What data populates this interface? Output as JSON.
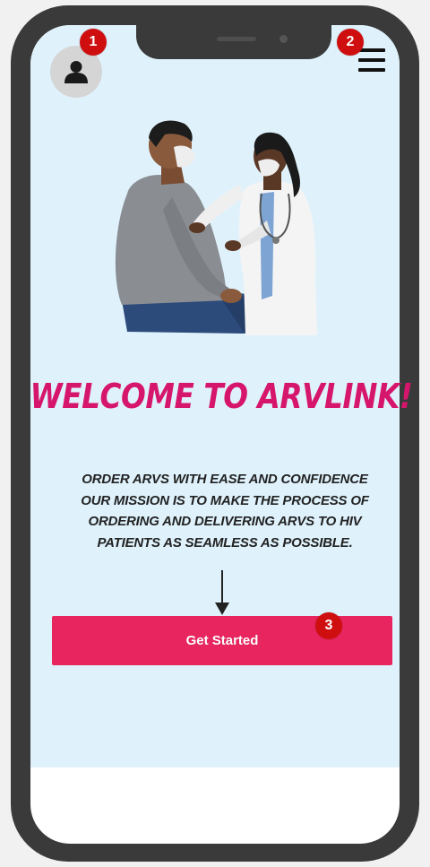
{
  "header": {
    "profile_icon": "person-icon",
    "menu_icon": "hamburger-menu-icon"
  },
  "annotations": {
    "badge_1": "1",
    "badge_2": "2",
    "badge_3": "3",
    "badge_color": "#cf0f0f"
  },
  "hero": {
    "image": "doctor-consulting-patient-illustration"
  },
  "welcome": {
    "title": "WELCOME TO  ARVLINK!",
    "tagline_lines": [
      "ORDER ARVS WITH EASE AND CONFIDENCE",
      "OUR MISSION IS TO MAKE THE PROCESS OF",
      "ORDERING AND DELIVERING ARVS TO HIV",
      "PATIENTS AS SEAMLESS AS POSSIBLE."
    ]
  },
  "cta": {
    "label": "Get Started"
  },
  "colors": {
    "accent": "#e8255f",
    "title": "#d6166c",
    "screen_background": "#dff2fc",
    "phone_frame": "#3a3a3a"
  }
}
